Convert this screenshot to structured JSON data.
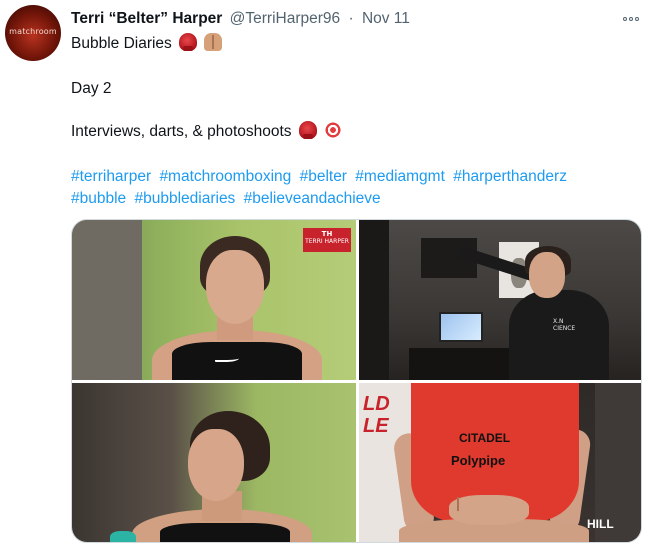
{
  "author": {
    "display_name": "Terri “Belter” Harper",
    "handle": "@TerriHarper96",
    "date": "Nov 11",
    "avatar_text": "matchroom"
  },
  "tweet": {
    "line_1": "Bubble Diaries",
    "line_1_emoji": [
      "boxing-glove-icon",
      "raising-hands-icon"
    ],
    "line_2": "Day 2",
    "line_3": "Interviews, darts, & photoshoots",
    "line_3_emoji": [
      "boxing-glove-icon",
      "dart-target-icon"
    ],
    "hashtags": [
      "#terriharper",
      "#matchroomboxing",
      "#belter",
      "#mediamgmt",
      "#harperthanderz",
      "#bubble",
      "#bubblediaries",
      "#believeandachieve"
    ]
  },
  "media": {
    "photo_1_logo_mark": "TH",
    "photo_1_logo_text": "TERRI HARPER",
    "photo_2_hoodie_text": "X.N\nCIENCE",
    "photo_4_shirt_text_1": "CITADEL",
    "photo_4_shirt_text_2": "Polypipe",
    "photo_4_wall_text": "LD\nLE",
    "photo_4_sponsor": "HILL"
  },
  "colors": {
    "link": "#1d9bf0",
    "secondary_text": "#536471",
    "primary_text": "#0f1419",
    "border": "#cfd9de"
  },
  "icons": {
    "more": "more-horizontal-icon"
  }
}
